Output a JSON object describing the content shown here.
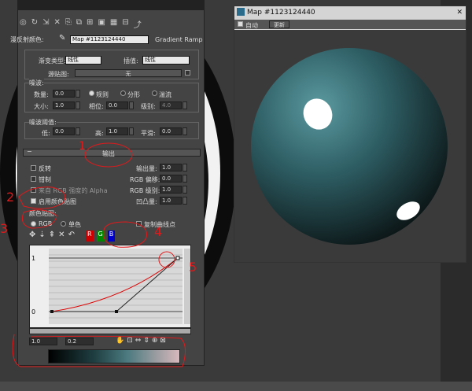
{
  "toolbar": {
    "type_label": "漫反射颜色:",
    "map_name": "Map #1123124440",
    "map_type": "Gradient Ramp"
  },
  "gradient": {
    "type_label": "渐变类型:",
    "type_value": "线性",
    "interp_label": "插值:",
    "interp_value": "线性",
    "source_label": "源贴图:",
    "source_value": "无"
  },
  "noise": {
    "title": "噪波:",
    "amount_label": "数量:",
    "amount": "0.0",
    "regular": "规则",
    "fractal": "分形",
    "turbulence": "湍流",
    "size_label": "大小:",
    "size": "1.0",
    "phase_label": "相位:",
    "phase": "0.0",
    "levels_label": "级别:",
    "levels": "4.0"
  },
  "threshold": {
    "title": "噪波阈值:",
    "low_label": "低:",
    "low": "0.0",
    "high_label": "高:",
    "high": "1.0",
    "smooth_label": "平滑:",
    "smooth": "0.0"
  },
  "output": {
    "title": "输出",
    "invert": "反转",
    "clamp": "钳制",
    "alpha_from_rgb": "来自 RGB 强度的 Alpha",
    "enable_color_map": "启用颜色贴图",
    "amount_label": "输出量:",
    "amount": "1.0",
    "rgb_offset_label": "RGB 偏移:",
    "rgb_offset": "0.0",
    "rgb_level_label": "RGB 级别:",
    "rgb_level": "1.0",
    "bump_label": "凹凸量:",
    "bump": "1.0"
  },
  "color_map": {
    "title": "颜色贴图:",
    "rgb": "RGB",
    "mono": "单色",
    "copy_points": "复制曲线点",
    "r": "R",
    "g": "G",
    "b": "B",
    "y_top": "1",
    "y_bottom": "0",
    "pos_value": "1.0",
    "val_value": "0.2"
  },
  "map_window": {
    "title": "Map #1123124440",
    "auto_label": "自动",
    "update_label": "更新"
  },
  "annotations": [
    "1",
    "2",
    "3",
    "4",
    "5"
  ],
  "colors": {
    "accent_red": "#e0191b",
    "panel_bg": "#444444",
    "sphere_teal": "#3c7278"
  }
}
